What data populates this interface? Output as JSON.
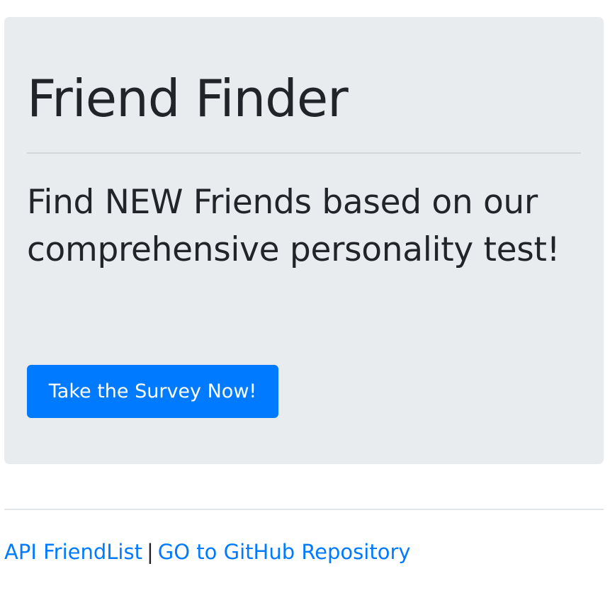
{
  "jumbotron": {
    "title": "Friend Finder",
    "subtitle": "Find NEW Friends based on our comprehensive personality test!",
    "button_label": "Take the Survey Now!"
  },
  "footer": {
    "api_link_label": "API FriendList",
    "separator": "|",
    "github_link_label": "GO to GitHub Repository"
  },
  "colors": {
    "primary": "#007bff",
    "jumbotron_bg": "#e9ecef",
    "text": "#212529"
  }
}
